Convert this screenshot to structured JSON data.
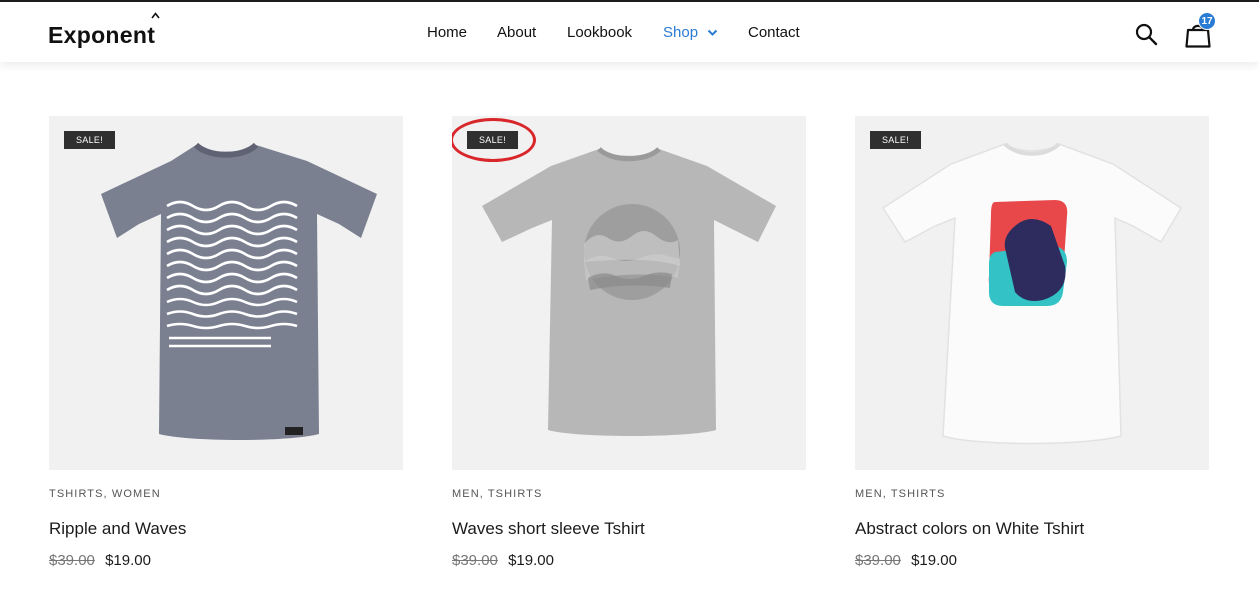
{
  "header": {
    "logo": "Exponent",
    "nav": [
      {
        "label": "Home"
      },
      {
        "label": "About"
      },
      {
        "label": "Lookbook"
      },
      {
        "label": "Shop",
        "active": true
      },
      {
        "label": "Contact"
      }
    ],
    "cart_count": "17"
  },
  "colors": {
    "accent": "#2a7bd3",
    "sale_badge": "#2f2f2f",
    "highlight": "#d8262a"
  },
  "products": [
    {
      "sale_label": "SALE!",
      "categories": "TSHIRTS, WOMEN",
      "title": "Ripple and Waves",
      "old_price": "$39.00",
      "price": "$19.00",
      "shirt_color": "grey-heather"
    },
    {
      "sale_label": "SALE!",
      "categories": "MEN, TSHIRTS",
      "title": "Waves short sleeve Tshirt",
      "old_price": "$39.00",
      "price": "$19.00",
      "shirt_color": "light-grey",
      "highlighted": true
    },
    {
      "sale_label": "SALE!",
      "categories": "MEN, TSHIRTS",
      "title": "Abstract colors on White Tshirt",
      "old_price": "$39.00",
      "price": "$19.00",
      "shirt_color": "white"
    }
  ]
}
